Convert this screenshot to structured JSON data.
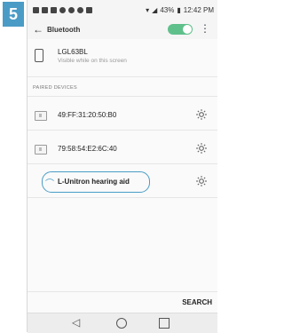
{
  "step_badge": "5",
  "statusbar": {
    "signal_text": "43%",
    "time": "12:42 PM"
  },
  "appbar": {
    "title": "Bluetooth",
    "bluetooth_enabled": true
  },
  "this_device": {
    "name": "LGL63BL",
    "subtitle": "Visible while on this screen"
  },
  "paired_section": {
    "header": "PAIRED DEVICES",
    "devices": [
      {
        "label": "49:FF:31:20:50:B0"
      },
      {
        "label": "79:58:54:E2:6C:40"
      },
      {
        "label": "L-Unitron hearing aid"
      }
    ]
  },
  "actions": {
    "search_label": "SEARCH"
  },
  "colors": {
    "accent": "#4a9cc6",
    "toggle_on": "#5fc08b"
  },
  "icons": {
    "back": "back-arrow-icon",
    "menu": "overflow-menu-icon",
    "gear": "gear-icon",
    "hearing": "hearing-aid-icon",
    "phone": "phone-icon"
  }
}
